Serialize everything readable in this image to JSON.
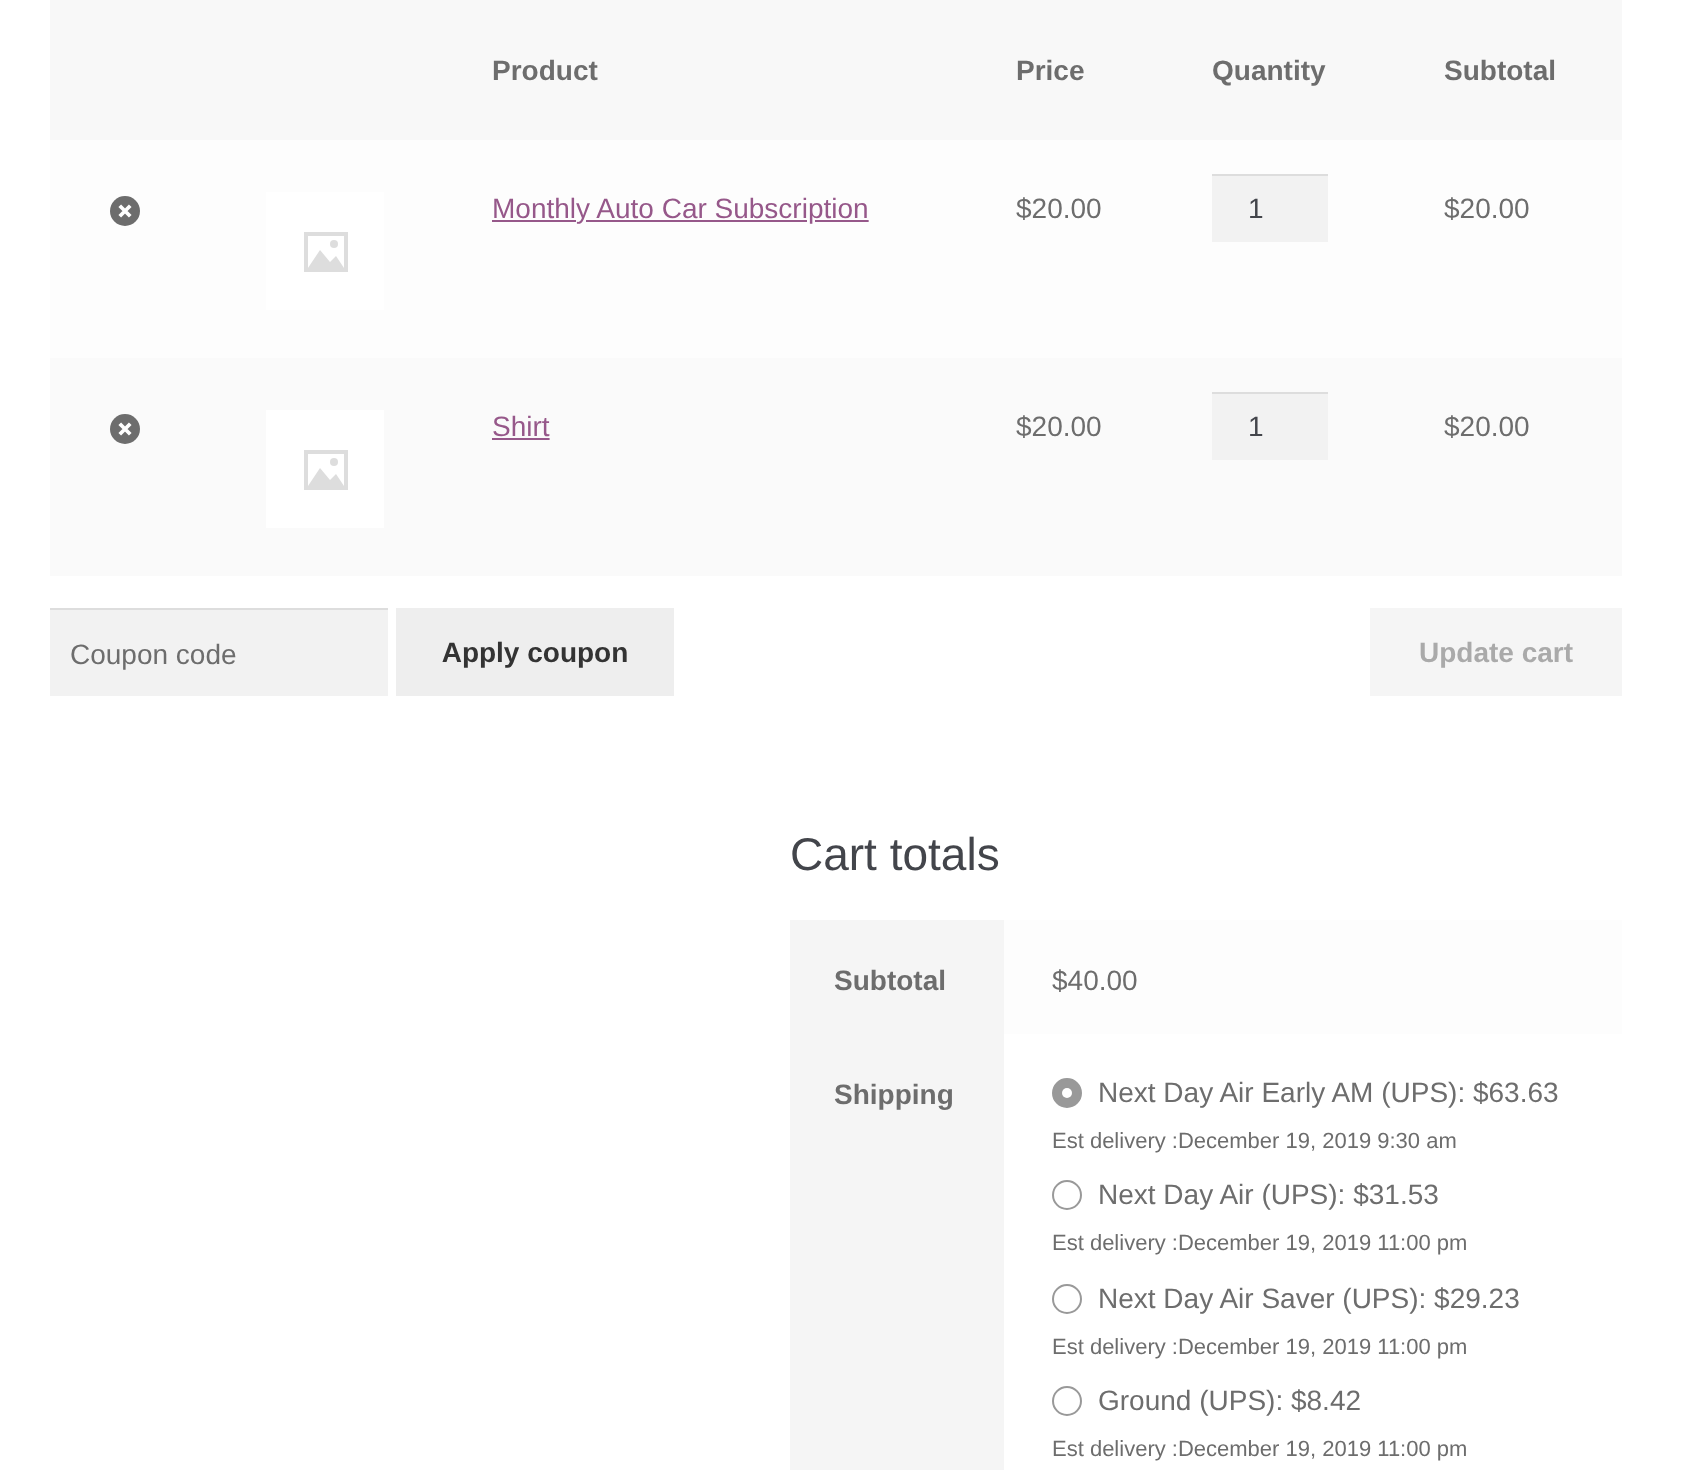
{
  "cart_table": {
    "columns": [
      "Product",
      "Price",
      "Quantity",
      "Subtotal"
    ],
    "rows": [
      {
        "product": "Monthly Auto Car Subscription",
        "price": "$20.00",
        "quantity": "1",
        "subtotal": "$20.00"
      },
      {
        "product": "Shirt",
        "price": "$20.00",
        "quantity": "1",
        "subtotal": "$20.00"
      }
    ]
  },
  "coupon": {
    "placeholder": "Coupon code",
    "apply_button": "Apply coupon"
  },
  "update_button": {
    "label": "Update cart",
    "disabled": true
  },
  "cart_totals": {
    "title": "Cart totals",
    "subtotal_label": "Subtotal",
    "subtotal_value": "$40.00",
    "shipping_label": "Shipping",
    "shipping_options": [
      {
        "label": "Next Day Air Early AM (UPS): $63.63",
        "delivery": "Est delivery :December 19, 2019 9:30 am",
        "selected": true
      },
      {
        "label": "Next Day Air (UPS): $31.53",
        "delivery": "Est delivery :December 19, 2019 11:00 pm",
        "selected": false
      },
      {
        "label": "Next Day Air Saver (UPS): $29.23",
        "delivery": "Est delivery :December 19, 2019 11:00 pm",
        "selected": false
      },
      {
        "label": "Ground (UPS): $8.42",
        "delivery": "Est delivery :December 19, 2019 11:00 pm",
        "selected": false
      }
    ]
  }
}
